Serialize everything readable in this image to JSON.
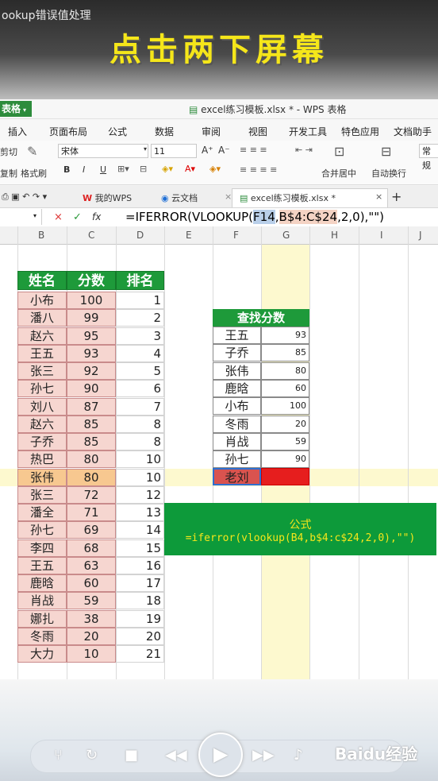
{
  "video": {
    "title": "ookup错误值处理",
    "banner": "点击两下屏幕"
  },
  "window": {
    "app_menu": "表格",
    "title": "excel练习模板.xlsx * - WPS 表格"
  },
  "ribbon_tabs": [
    "插入",
    "页面布局",
    "公式",
    "数据",
    "审阅",
    "视图",
    "开发工具",
    "特色应用",
    "文档助手"
  ],
  "ribbon": {
    "cut": "剪切",
    "copy": "复制",
    "format_painter": "格式刷",
    "font": "宋体",
    "font_size": "11",
    "merge_center": "合并居中",
    "wrap": "自动换行",
    "number_format": "常规",
    "bold": "B",
    "italic": "I",
    "underline": "U",
    "grow_font": "A⁺",
    "shrink_font": "A⁻"
  },
  "doc_tabs": {
    "mywps": "我的WPS",
    "cloud": "云文档",
    "active": "excel练习模板.xlsx *",
    "add": "+"
  },
  "formula_bar": {
    "fx": "fx",
    "prefix": "=IFERROR(VLOOKUP(",
    "ref1": "F14",
    "comma": ",",
    "ref2": "B$4:C$24",
    "suffix": ",2,0),\"\")"
  },
  "columns": [
    "B",
    "C",
    "D",
    "E",
    "F",
    "G",
    "H",
    "I",
    "J"
  ],
  "main_table": {
    "headers": [
      "姓名",
      "分数",
      "排名"
    ],
    "rows": [
      {
        "name": "小布",
        "score": "100",
        "rank": "1"
      },
      {
        "name": "潘八",
        "score": "99",
        "rank": "2"
      },
      {
        "name": "赵六",
        "score": "95",
        "rank": "3"
      },
      {
        "name": "王五",
        "score": "93",
        "rank": "4"
      },
      {
        "name": "张三",
        "score": "92",
        "rank": "5"
      },
      {
        "name": "孙七",
        "score": "90",
        "rank": "6"
      },
      {
        "name": "刘八",
        "score": "87",
        "rank": "7"
      },
      {
        "name": "赵六",
        "score": "85",
        "rank": "8"
      },
      {
        "name": "子乔",
        "score": "85",
        "rank": "8"
      },
      {
        "name": "热巴",
        "score": "80",
        "rank": "10"
      },
      {
        "name": "张伟",
        "score": "80",
        "rank": "10"
      },
      {
        "name": "张三",
        "score": "72",
        "rank": "12"
      },
      {
        "name": "潘全",
        "score": "71",
        "rank": "13"
      },
      {
        "name": "孙七",
        "score": "69",
        "rank": "14"
      },
      {
        "name": "李四",
        "score": "68",
        "rank": "15"
      },
      {
        "name": "王五",
        "score": "63",
        "rank": "16"
      },
      {
        "name": "鹿晗",
        "score": "60",
        "rank": "17"
      },
      {
        "name": "肖战",
        "score": "59",
        "rank": "18"
      },
      {
        "name": "娜扎",
        "score": "38",
        "rank": "19"
      },
      {
        "name": "冬雨",
        "score": "20",
        "rank": "20"
      },
      {
        "name": "大力",
        "score": "10",
        "rank": "21"
      }
    ]
  },
  "lookup_table": {
    "header": "查找分数",
    "rows": [
      {
        "name": "王五",
        "score": "93"
      },
      {
        "name": "子乔",
        "score": "85"
      },
      {
        "name": "张伟",
        "score": "80"
      },
      {
        "name": "鹿晗",
        "score": "60"
      },
      {
        "name": "小布",
        "score": "100"
      },
      {
        "name": "冬雨",
        "score": "20"
      },
      {
        "name": "肖战",
        "score": "59"
      },
      {
        "name": "孙七",
        "score": "90"
      },
      {
        "name": "老刘",
        "score": ""
      }
    ]
  },
  "formula_note": {
    "label": "公式",
    "text": "=iferror(vlookup(B4,b$4:c$24,2,0),\"\")"
  },
  "watermark": "Baidu经验",
  "colors": {
    "header_green": "#1e9a3a",
    "pink_fill": "#f6d6d0",
    "highlight_yellow": "#fdf9cf",
    "error_red": "#e61e1e",
    "banner_yellow": "#f5e61a"
  }
}
